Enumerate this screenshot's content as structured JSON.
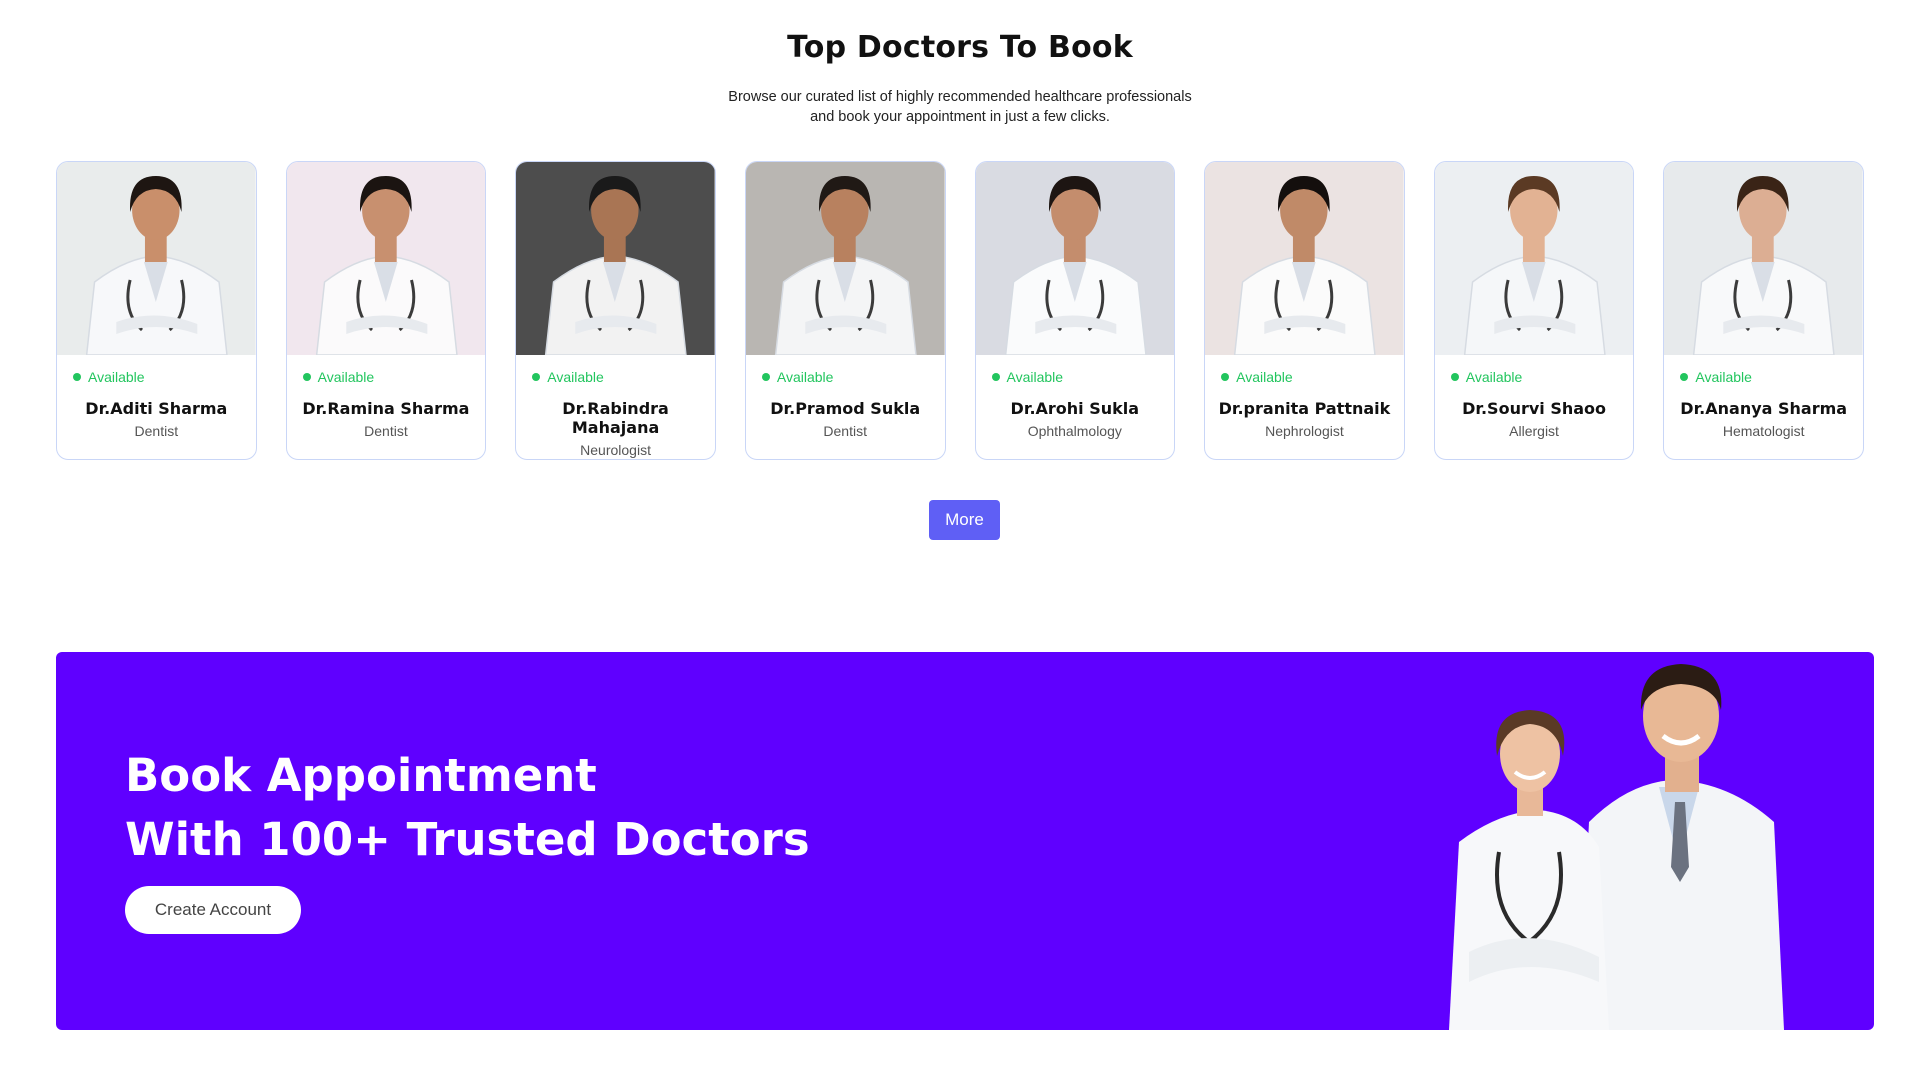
{
  "section": {
    "title": "Top Doctors To Book",
    "subtitle": "Browse our curated list of highly recommended healthcare professionals and book your appointment in just a few clicks."
  },
  "doctors": [
    {
      "name": "Dr.Aditi Sharma",
      "speciality": "Dentist",
      "status": "Available",
      "bg": "#e9ecec",
      "coat": "#f7f8fa",
      "skin": "#c98f6b",
      "hair": "#1e1612"
    },
    {
      "name": "Dr.Ramina Sharma",
      "speciality": "Dentist",
      "status": "Available",
      "bg": "#f1e7ee",
      "coat": "#fbfafb",
      "skin": "#c8906f",
      "hair": "#1b1411"
    },
    {
      "name": "Dr.Rabindra Mahajana",
      "speciality": "Neurologist",
      "status": "Available",
      "bg": "#4d4d4d",
      "coat": "#f2f2f2",
      "skin": "#a97554",
      "hair": "#1a1a1a"
    },
    {
      "name": "Dr.Pramod Sukla",
      "speciality": "Dentist",
      "status": "Available",
      "bg": "#b9b6b2",
      "coat": "#f4f5f6",
      "skin": "#b8815f",
      "hair": "#201915"
    },
    {
      "name": "Dr.Arohi Sukla",
      "speciality": "Ophthalmology",
      "status": "Available",
      "bg": "#d9dbe2",
      "coat": "#fafbfc",
      "skin": "#c48d6d",
      "hair": "#1d1512"
    },
    {
      "name": "Dr.pranita Pattnaik",
      "speciality": "Nephrologist",
      "status": "Available",
      "bg": "#ebe3e2",
      "coat": "#fbfbfb",
      "skin": "#c08a68",
      "hair": "#140f0d"
    },
    {
      "name": "Dr.Sourvi Shaoo",
      "speciality": "Allergist",
      "status": "Available",
      "bg": "#eceff2",
      "coat": "#f5f7f9",
      "skin": "#e2b293",
      "hair": "#5b3a24"
    },
    {
      "name": "Dr.Ananya Sharma",
      "speciality": "Hematologist",
      "status": "Available",
      "bg": "#e7eaec",
      "coat": "#f8f9fa",
      "skin": "#dcae93",
      "hair": "#3a2416"
    }
  ],
  "more_label": "More",
  "banner": {
    "line1": "Book Appointment",
    "line2": "With 100+ Trusted Doctors",
    "cta": "Create Account",
    "bg": "#5f00ff"
  }
}
